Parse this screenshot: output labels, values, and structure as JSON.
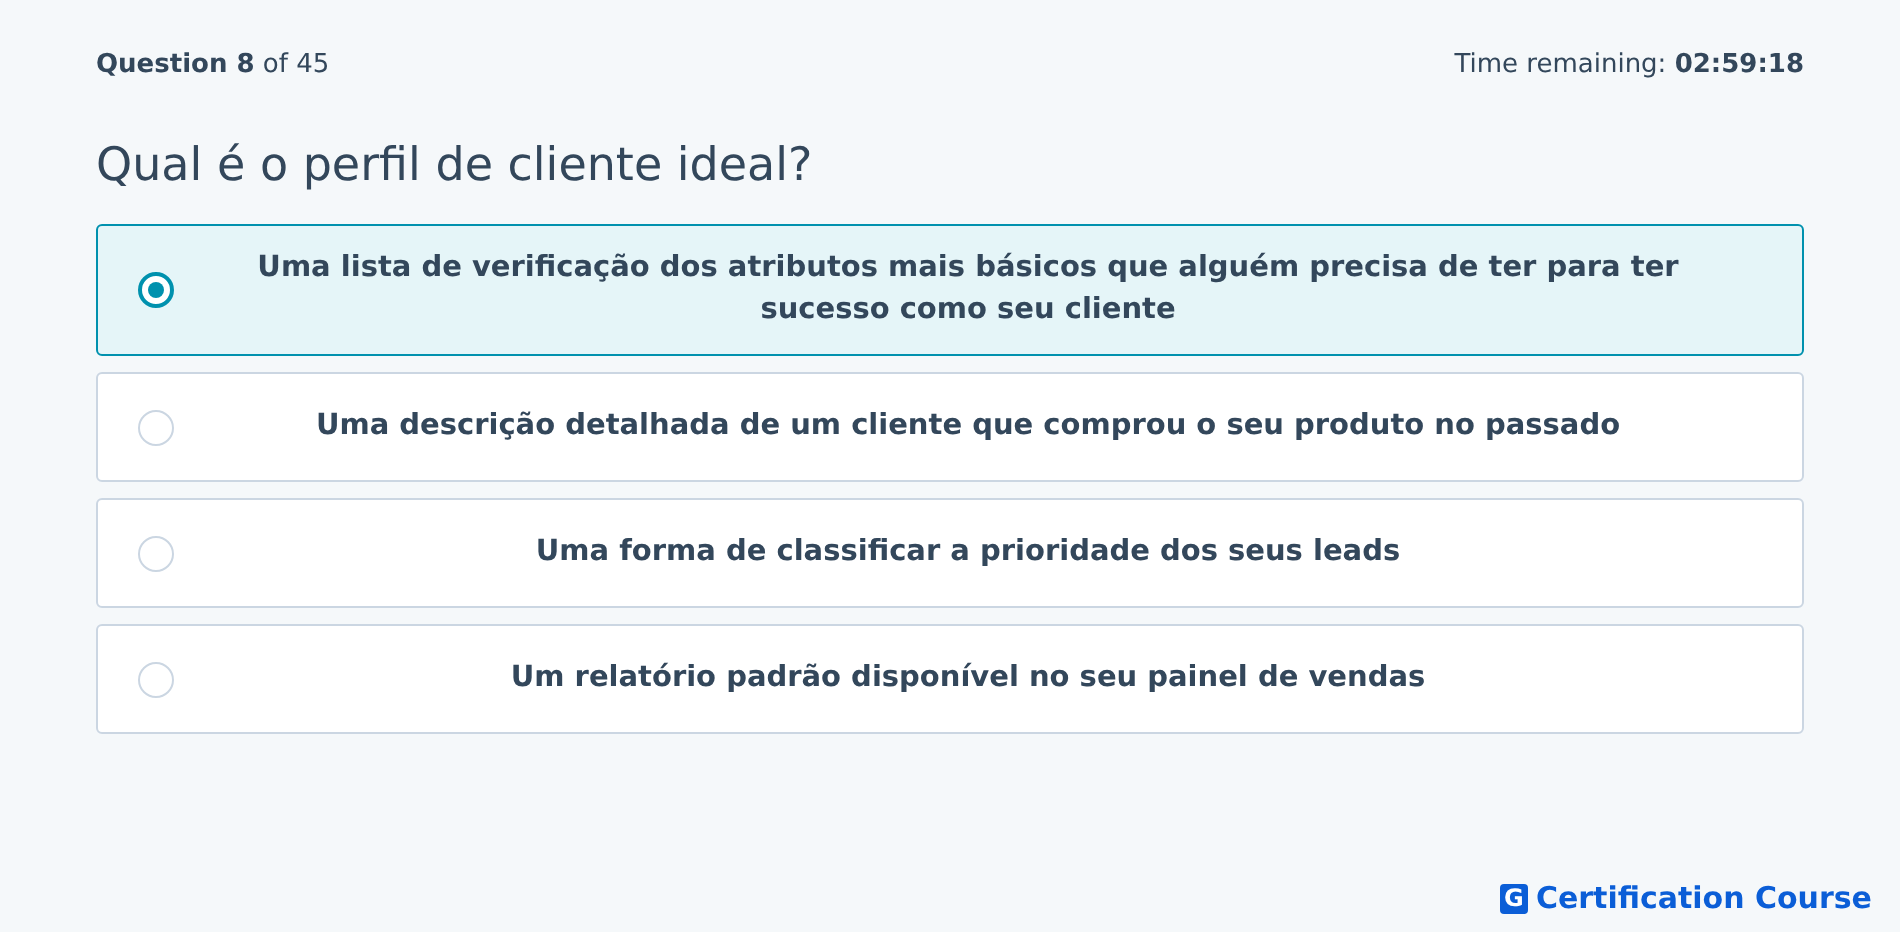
{
  "header": {
    "progress": "**Question 8** of 45",
    "timer_label": "Time remaining:",
    "timer_value": "02:59:18"
  },
  "question": "Qual é o perfil de cliente ideal?",
  "options": [
    {
      "label": "Uma lista de verificação dos atributos mais básicos que alguém precisa de ter para ter sucesso como seu cliente",
      "selected": true
    },
    {
      "label": "Uma descrição detalhada de um cliente que comprou o seu produto no passado",
      "selected": false
    },
    {
      "label": "Uma forma de classificar a prioridade dos seus leads",
      "selected": false
    },
    {
      "label": "Um relatório padrão disponível no seu painel de vendas",
      "selected": false
    }
  ],
  "footer": {
    "logo_letter": "G",
    "brand": "Certification Course"
  }
}
